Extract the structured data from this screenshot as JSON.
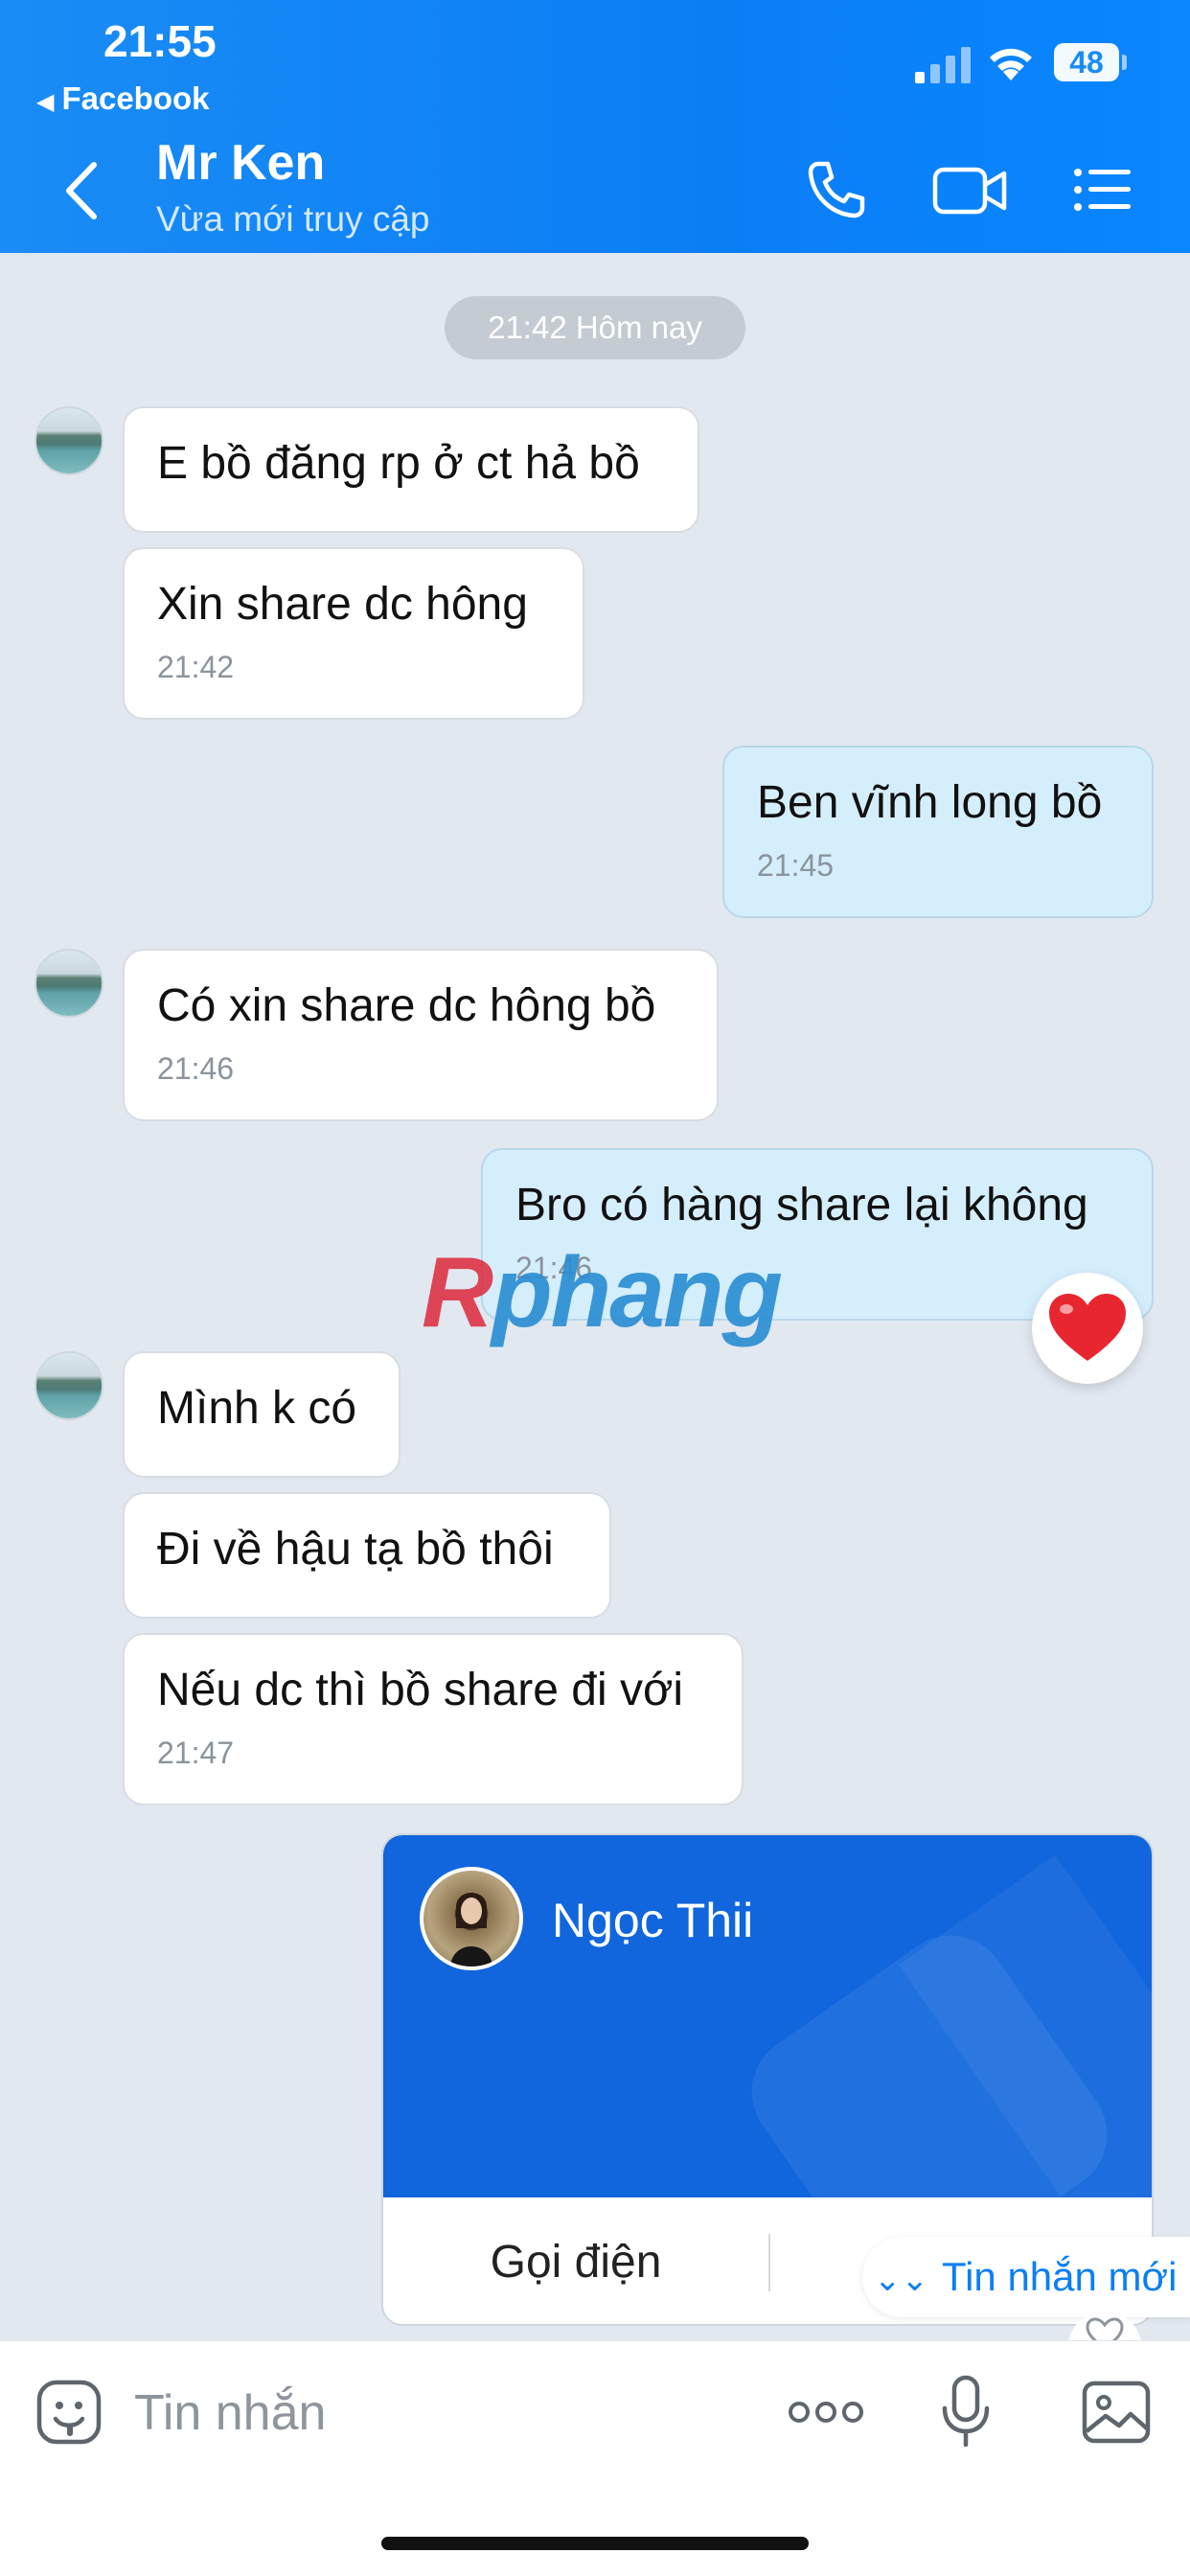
{
  "status_bar": {
    "time": "21:55",
    "back_app": "Facebook",
    "battery": "48"
  },
  "header": {
    "contact_name": "Mr Ken",
    "contact_status": "Vừa mới truy cập"
  },
  "chat": {
    "time_separator": "21:42 Hôm nay",
    "messages": [
      {
        "dir": "in",
        "text": "E bồ đăng rp ở ct hả bồ",
        "time": ""
      },
      {
        "dir": "in",
        "text": "Xin share dc hông",
        "time": "21:42"
      },
      {
        "dir": "out",
        "text": "Ben vĩnh long bồ",
        "time": "21:45"
      },
      {
        "dir": "in",
        "text": "Có xin share dc hông bồ",
        "time": "21:46"
      },
      {
        "dir": "out",
        "text": "Bro có hàng share lại không",
        "time": "21:46"
      },
      {
        "dir": "in",
        "text": "Mình k có",
        "time": ""
      },
      {
        "dir": "in",
        "text": "Đi về hậu tạ bồ thôi",
        "time": ""
      },
      {
        "dir": "in",
        "text": "Nếu dc thì bồ share đi với",
        "time": "21:47"
      }
    ],
    "watermark": {
      "part1": "R",
      "part2": "phang"
    },
    "contact_card": {
      "name": "Ngọc Thii",
      "call_label": "Gọi điện"
    },
    "new_message_label": "Tin nhắn mới"
  },
  "input_bar": {
    "placeholder": "Tin nhắn"
  },
  "colors": {
    "header_blue": "#0b7ef6",
    "card_blue": "#1166dd",
    "outgoing_bubble": "#d5eefc",
    "reaction_heart": "#e8262f"
  }
}
